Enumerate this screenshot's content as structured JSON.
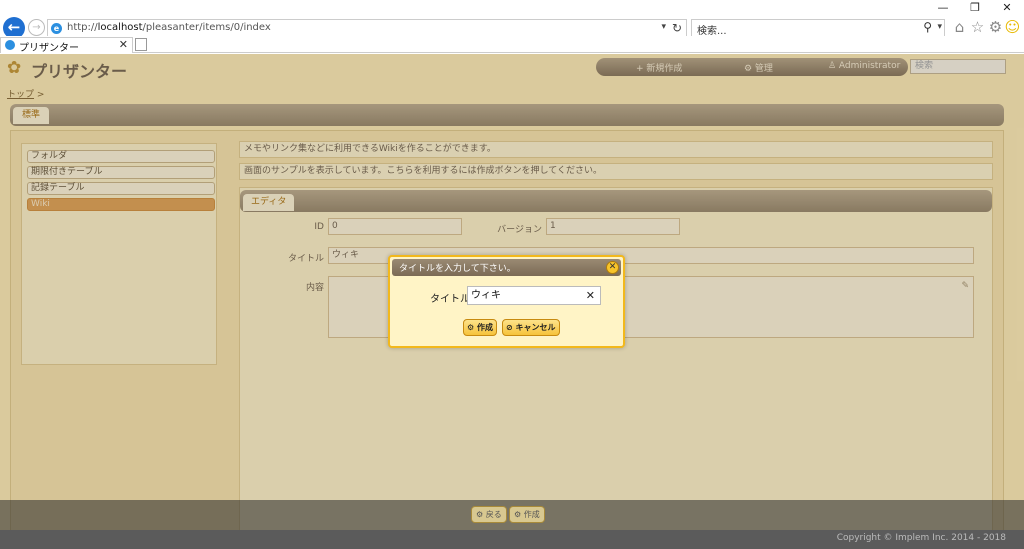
{
  "browser": {
    "window_controls": {
      "minimize": "—",
      "maximize": "❐",
      "close": "✕"
    },
    "url_prefix": "http://",
    "url_host": "localhost",
    "url_path": "/pleasanter/items/0/index",
    "search_placeholder": "検索...",
    "tab_title": "プリザンター",
    "tab_close": "✕"
  },
  "app": {
    "logo_text": "プリザンター",
    "topnav": {
      "new": "+ 新規作成",
      "manage": "⚙ 管理",
      "user": "♙ Administrator"
    },
    "search_placeholder": "検索",
    "breadcrumb_top": "トップ",
    "breadcrumb_sep": ">",
    "main_tab": "標準"
  },
  "sidebar": {
    "items": [
      {
        "label": "フォルダ"
      },
      {
        "label": "期限付きテーブル"
      },
      {
        "label": "記録テーブル"
      },
      {
        "label": "Wiki"
      }
    ]
  },
  "info": {
    "line1": "メモやリンク集などに利用できるWikiを作ることができます。",
    "line2": "画面のサンプルを表示しています。こちらを利用するには作成ボタンを押してください。"
  },
  "editor": {
    "tab": "エディタ",
    "id_label": "ID",
    "id_value": "0",
    "version_label": "バージョン",
    "version_value": "1",
    "title_label": "タイトル",
    "title_value": "ウィキ",
    "body_label": "内容"
  },
  "dialog": {
    "title": "タイトルを入力して下さい。",
    "close": "✕",
    "field_label": "タイトル",
    "field_value": "ウィキ",
    "clear": "✕",
    "create_button": "⚙ 作成",
    "cancel_button": "⊘ キャンセル"
  },
  "footer": {
    "back_button": "⚙ 戻る",
    "create_button": "⚙ 作成",
    "copyright": "Copyright © Implem Inc. 2014 - 2018"
  }
}
